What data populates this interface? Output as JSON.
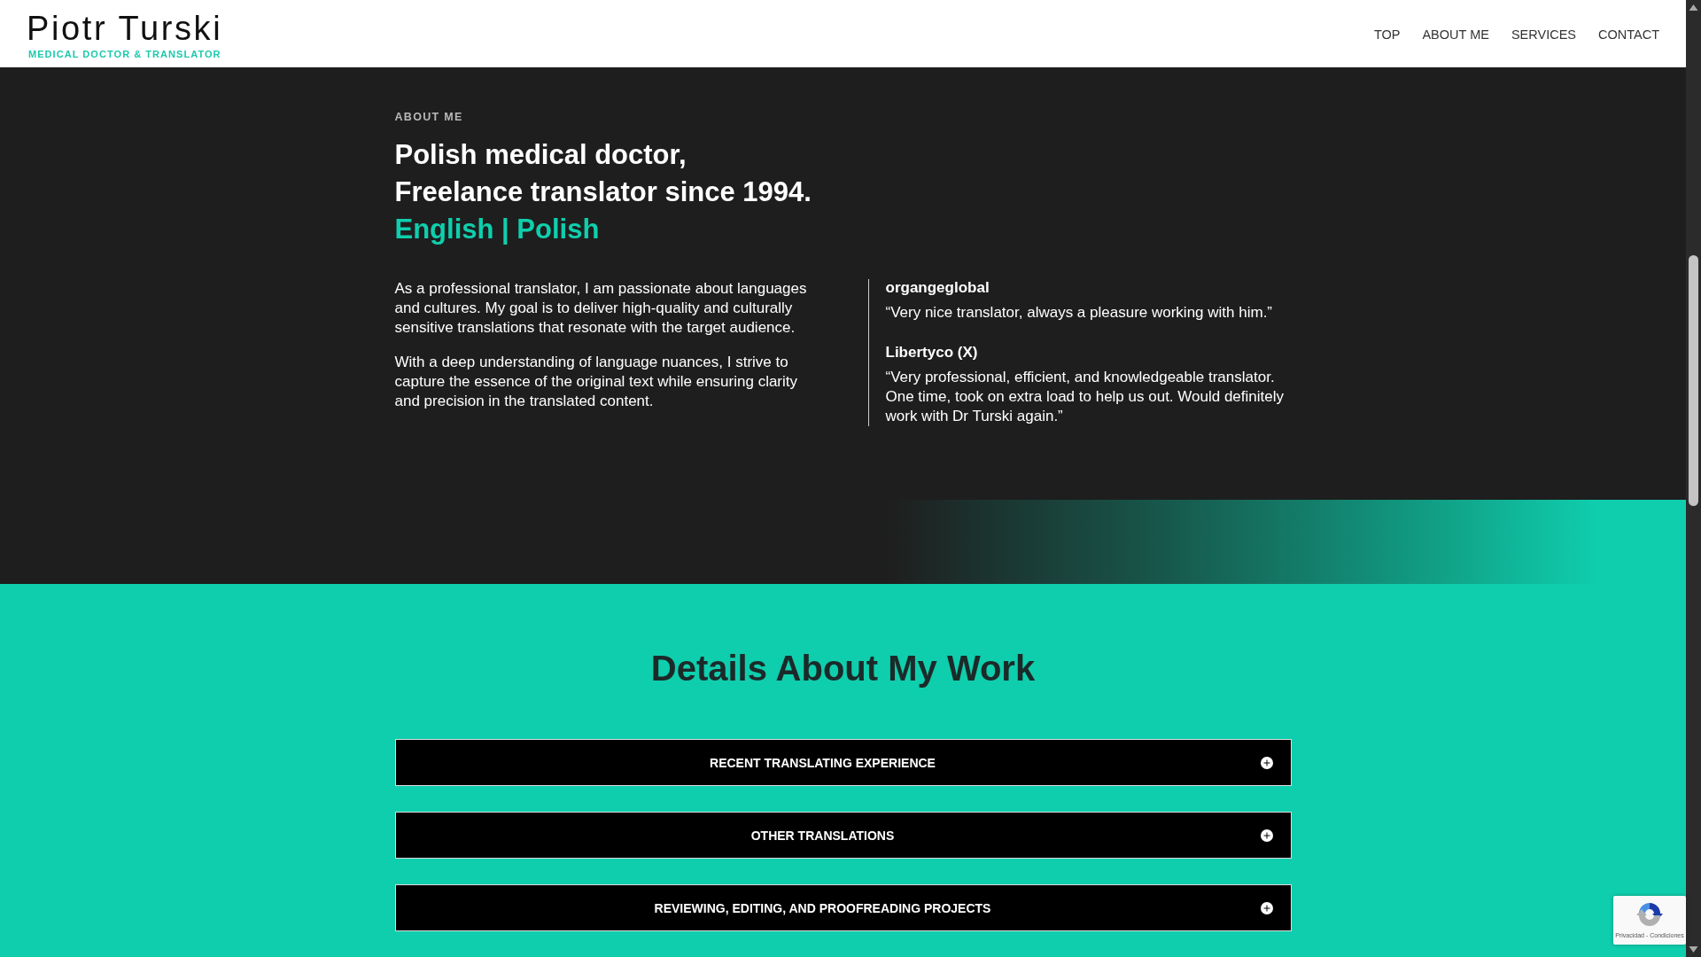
{
  "header": {
    "logo": {
      "name": "Piotr Turski",
      "tagline": "MEDICAL DOCTOR & TRANSLATOR"
    },
    "nav": [
      {
        "label": "TOP"
      },
      {
        "label": "ABOUT ME"
      },
      {
        "label": "SERVICES"
      },
      {
        "label": "CONTACT"
      }
    ]
  },
  "about": {
    "eyebrow": "ABOUT ME",
    "headline": [
      "Polish medical doctor,",
      "Freelance translator since 1994."
    ],
    "languages": "English | Polish",
    "paragraphs": [
      "As a professional translator, I am passionate about languages and cultures. My goal is to deliver high-quality and culturally sensitive translations that resonate with the target audience.",
      "With a deep understanding of language nuances, I strive to capture the essence of the original text while ensuring clarity and precision in the translated content."
    ],
    "testimonials": [
      {
        "author": "organgeglobal",
        "quote": "“Very nice translator, always a pleasure working with him.”"
      },
      {
        "author": "Libertyco (X)",
        "quote": "“Very professional, efficient, and knowledgeable translator. One time, took on extra load to help us out. Would definitely work with Dr Turski again.”"
      }
    ]
  },
  "work": {
    "title": "Details About My Work",
    "toggles": [
      {
        "title": "RECENT TRANSLATING EXPERIENCE",
        "expanded": false
      },
      {
        "title": "OTHER TRANSLATIONS",
        "expanded": false
      },
      {
        "title": "REVIEWING, EDITING, AND PROOFREADING PROJECTS",
        "expanded": false
      }
    ]
  },
  "recaptcha": {
    "links": "Privacidad - Condiciones"
  }
}
